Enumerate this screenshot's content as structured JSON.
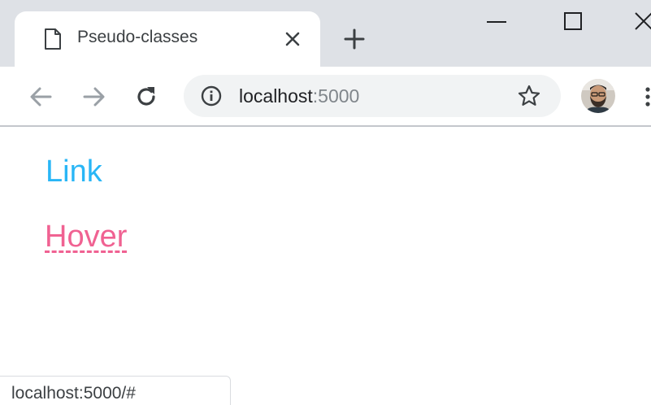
{
  "browser": {
    "tab": {
      "title": "Pseudo-classes",
      "favicon": "page-icon",
      "close": "close-icon"
    },
    "new_tab": "plus-icon",
    "window_controls": [
      "minimize-icon",
      "maximize-icon",
      "close-icon"
    ],
    "toolbar": {
      "back": "arrow-left-icon",
      "forward": "arrow-right-icon",
      "reload": "reload-icon",
      "site_info": "info-icon",
      "url_host": "localhost",
      "url_port": ":5000",
      "bookmark": "star-icon",
      "profile": "avatar",
      "menu": "kebab-menu-icon"
    }
  },
  "page": {
    "link_text": "Link",
    "hover_text": "Hover",
    "link_color": "#29b6f6",
    "hover_color": "#f06292"
  },
  "status_bar": {
    "url": "localhost:5000/#"
  }
}
